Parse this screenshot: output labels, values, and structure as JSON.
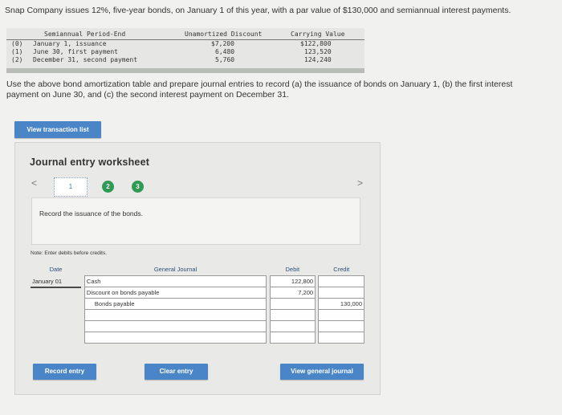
{
  "problem": {
    "text": "Snap Company issues 12%, five-year bonds, on January 1 of this year, with a par value of $130,000 and semiannual interest payments."
  },
  "amortization_table": {
    "headers": [
      "Semiannual Period-End",
      "Unamortized Discount",
      "Carrying Value"
    ],
    "rows": [
      {
        "num": "(0)",
        "label": "January 1, issuance",
        "discount": "$7,200",
        "carrying": "$122,800"
      },
      {
        "num": "(1)",
        "label": "June 30, first payment",
        "discount": "6,480",
        "carrying": "123,520"
      },
      {
        "num": "(2)",
        "label": "December 31, second payment",
        "discount": "5,760",
        "carrying": "124,240"
      }
    ]
  },
  "question": {
    "text": "Use the above bond amortization table and prepare journal entries to record (a) the issuance of bonds on January 1, (b) the first interest payment on June 30, and (c) the second interest payment on December 31."
  },
  "buttons": {
    "view_transaction_list": "View transaction list",
    "record_entry": "Record entry",
    "clear_entry": "Clear entry",
    "view_general_journal": "View general journal"
  },
  "worksheet": {
    "title": "Journal entry worksheet",
    "nav_prev": "<",
    "nav_next": ">",
    "pages": [
      "1",
      "2",
      "3"
    ],
    "instruction": "Record the issuance of the bonds.",
    "note": "Note: Enter debits before credits."
  },
  "journal": {
    "headers": {
      "date": "Date",
      "account": "General Journal",
      "debit": "Debit",
      "credit": "Credit"
    },
    "date": "January 01",
    "rows": [
      {
        "account": "Cash",
        "debit": "122,800",
        "credit": ""
      },
      {
        "account": "Discount on bonds payable",
        "debit": "7,200",
        "credit": ""
      },
      {
        "account": "Bonds payable",
        "debit": "",
        "credit": "130,000"
      },
      {
        "account": "",
        "debit": "",
        "credit": ""
      },
      {
        "account": "",
        "debit": "",
        "credit": ""
      },
      {
        "account": "",
        "debit": "",
        "credit": ""
      }
    ]
  },
  "colors": {
    "button_blue": "#4a86c7",
    "page_green": "#2f9a54",
    "background": "#f1f1ef"
  }
}
